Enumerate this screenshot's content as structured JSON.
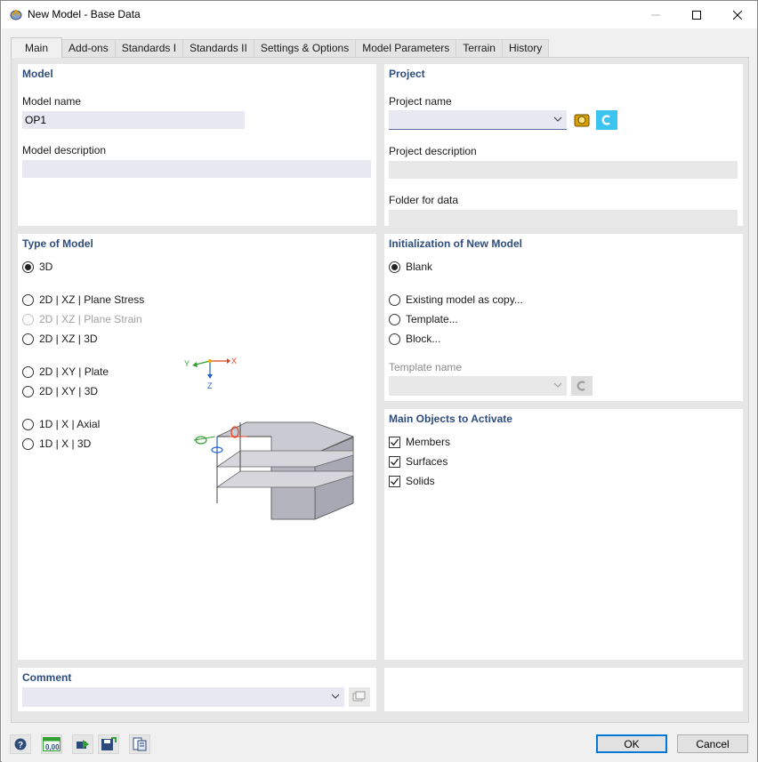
{
  "window": {
    "title": "New Model - Base Data",
    "icon": "app-icon"
  },
  "tabs": [
    {
      "label": "Main",
      "active": true
    },
    {
      "label": "Add-ons"
    },
    {
      "label": "Standards I"
    },
    {
      "label": "Standards II"
    },
    {
      "label": "Settings & Options"
    },
    {
      "label": "Model Parameters"
    },
    {
      "label": "Terrain"
    },
    {
      "label": "History"
    }
  ],
  "model": {
    "title": "Model",
    "name_label": "Model name",
    "name_value": "OP1",
    "description_label": "Model description",
    "description_value": ""
  },
  "project": {
    "title": "Project",
    "name_label": "Project name",
    "name_value": "",
    "description_label": "Project description",
    "description_value": "",
    "folder_label": "Folder for data",
    "folder_value": ""
  },
  "model_type": {
    "title": "Type of Model",
    "options": [
      {
        "label": "3D",
        "checked": true
      },
      {
        "label": "2D | XZ | Plane Stress"
      },
      {
        "label": "2D | XZ | Plane Strain",
        "disabled": true
      },
      {
        "label": "2D | XZ | 3D"
      },
      {
        "label": "2D | XY | Plate"
      },
      {
        "label": "2D | XY | 3D"
      },
      {
        "label": "1D | X | Axial"
      },
      {
        "label": "1D | X | 3D"
      }
    ],
    "axes": {
      "x": "X",
      "y": "Y",
      "z": "Z"
    }
  },
  "initialization": {
    "title": "Initialization of New Model",
    "options": [
      {
        "label": "Blank",
        "checked": true
      },
      {
        "label": "Existing model as copy..."
      },
      {
        "label": "Template..."
      },
      {
        "label": "Block..."
      }
    ],
    "template_label": "Template name",
    "template_value": ""
  },
  "main_objects": {
    "title": "Main Objects to Activate",
    "items": [
      {
        "label": "Members",
        "checked": true
      },
      {
        "label": "Surfaces",
        "checked": true
      },
      {
        "label": "Solids",
        "checked": true
      }
    ]
  },
  "comment": {
    "title": "Comment",
    "value": ""
  },
  "footer": {
    "ok_label": "OK",
    "cancel_label": "Cancel",
    "units_icon_text": "0,00"
  },
  "colors": {
    "section_title": "#2e4d7c",
    "input_bg": "#e8e8f3",
    "accent": "#0078d7",
    "axis_x": "#e04020",
    "axis_y": "#30a030",
    "axis_z": "#2060d0"
  }
}
